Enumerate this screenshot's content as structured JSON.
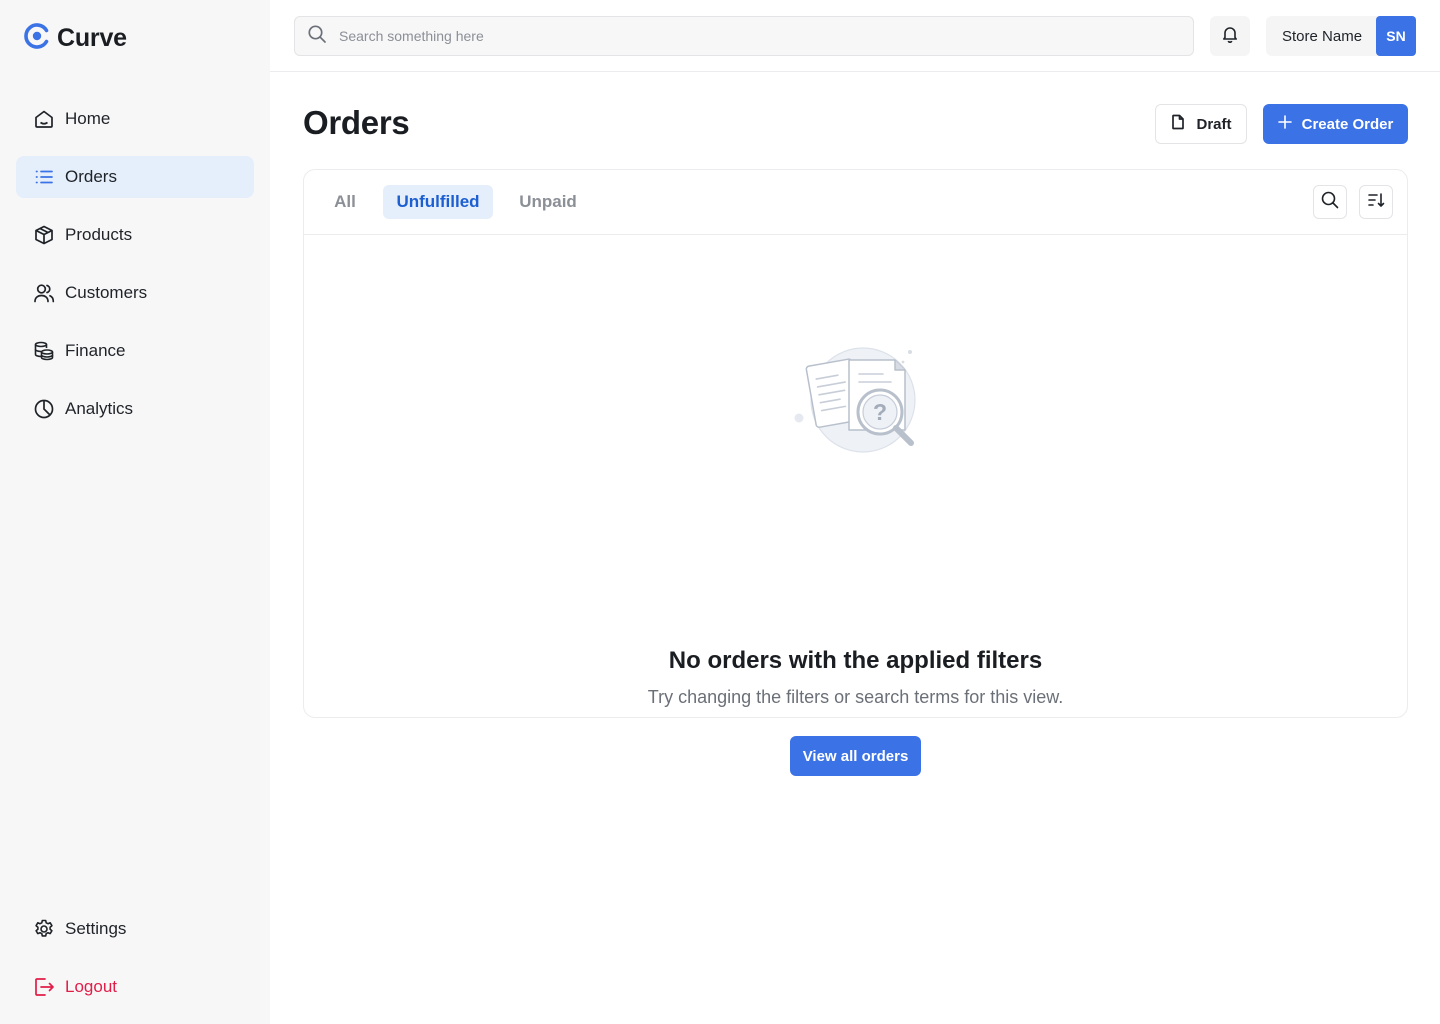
{
  "brand": {
    "name": "Curve",
    "color": "#3b72e6"
  },
  "sidebar": {
    "items": [
      {
        "label": "Home",
        "icon": "home-icon"
      },
      {
        "label": "Orders",
        "icon": "list-icon",
        "active": true
      },
      {
        "label": "Products",
        "icon": "box-icon"
      },
      {
        "label": "Customers",
        "icon": "users-icon"
      },
      {
        "label": "Finance",
        "icon": "coins-icon"
      },
      {
        "label": "Analytics",
        "icon": "pie-chart-icon"
      }
    ],
    "bottom": [
      {
        "label": "Settings",
        "icon": "gear-icon"
      },
      {
        "label": "Logout",
        "icon": "logout-icon",
        "color": "#e11d48"
      }
    ]
  },
  "topbar": {
    "search": {
      "placeholder": "Search something here",
      "value": ""
    },
    "store_name": "Store Name",
    "avatar_initials": "SN"
  },
  "header": {
    "title": "Orders",
    "draft_label": "Draft",
    "create_label": "Create Order"
  },
  "tabs": [
    {
      "label": "All",
      "active": false
    },
    {
      "label": "Unfulfilled",
      "active": true
    },
    {
      "label": "Unpaid",
      "active": false
    }
  ],
  "empty_state": {
    "title": "No orders with the applied filters",
    "subtitle": "Try changing the filters or search terms for this view.",
    "button_label": "View all orders"
  }
}
